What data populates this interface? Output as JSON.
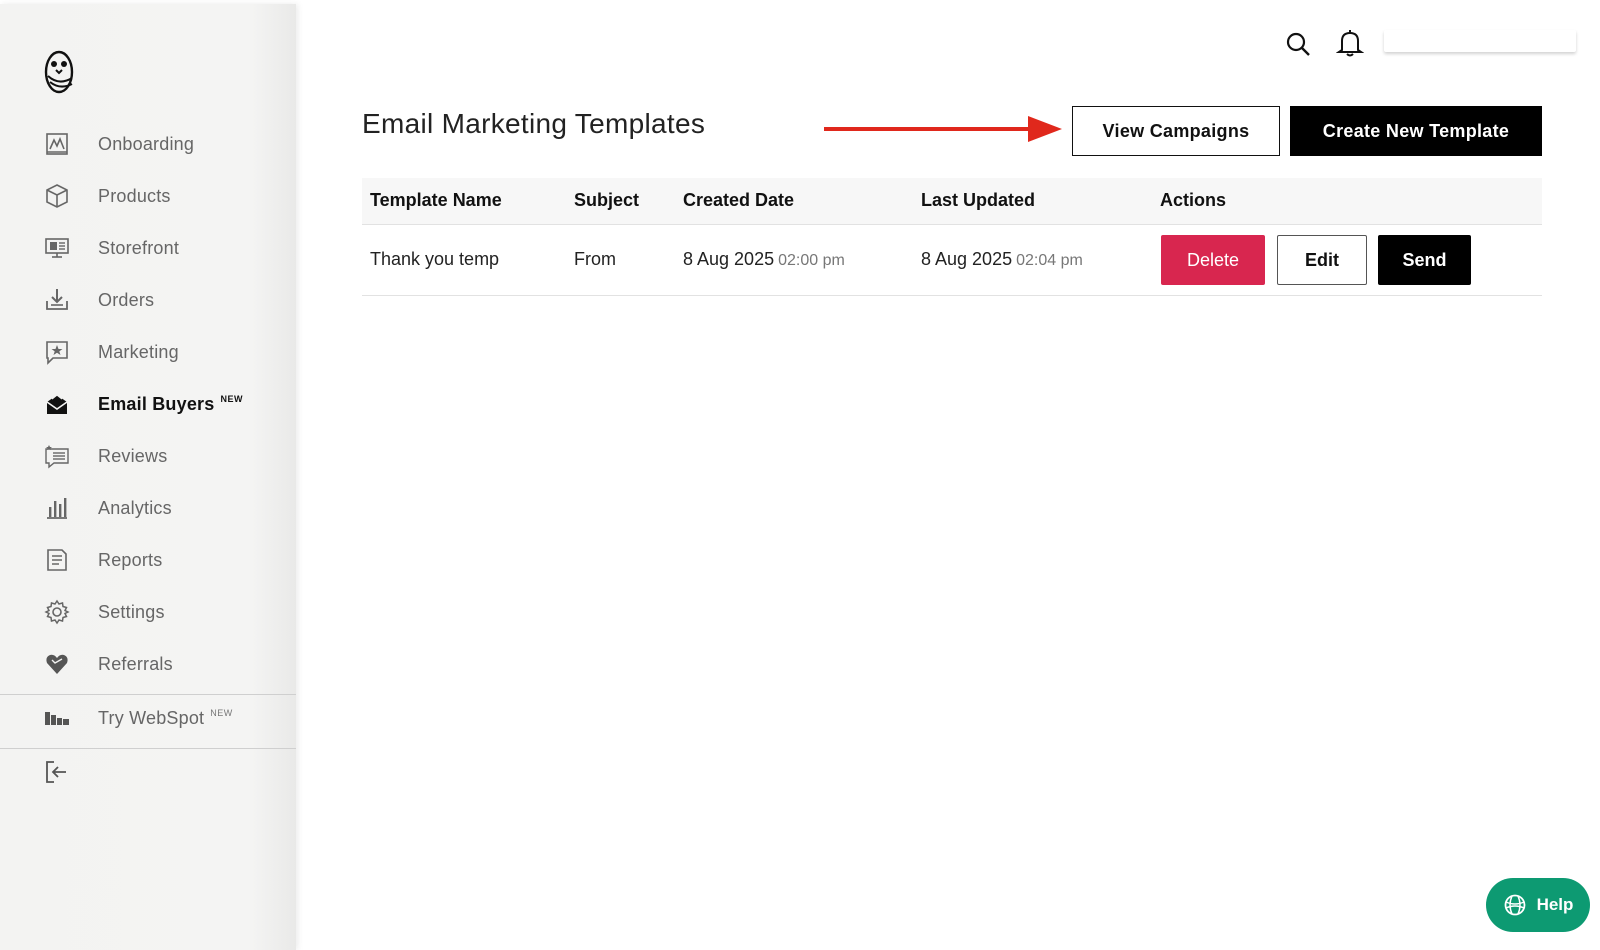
{
  "sidebar": {
    "items": [
      {
        "id": "onboarding",
        "label": "Onboarding",
        "icon": "onboarding-chart-icon"
      },
      {
        "id": "products",
        "label": "Products",
        "icon": "box-icon"
      },
      {
        "id": "storefront",
        "label": "Storefront",
        "icon": "monitor-icon"
      },
      {
        "id": "orders",
        "label": "Orders",
        "icon": "download-tray-icon"
      },
      {
        "id": "marketing",
        "label": "Marketing",
        "icon": "star-message-icon"
      },
      {
        "id": "email-buyers",
        "label": "Email Buyers",
        "badge": "NEW",
        "icon": "envelope-icon",
        "active": true
      },
      {
        "id": "reviews",
        "label": "Reviews",
        "icon": "review-list-icon"
      },
      {
        "id": "analytics",
        "label": "Analytics",
        "icon": "bar-chart-icon"
      },
      {
        "id": "reports",
        "label": "Reports",
        "icon": "document-icon"
      },
      {
        "id": "settings",
        "label": "Settings",
        "icon": "gear-icon"
      },
      {
        "id": "referrals",
        "label": "Referrals",
        "icon": "heart-icon"
      }
    ],
    "webspot": {
      "label": "Try WebSpot",
      "badge": "NEW",
      "icon": "webspot-icon"
    },
    "logout_icon": "logout-icon"
  },
  "header": {
    "search_icon": "search-icon",
    "bell_icon": "bell-icon"
  },
  "main": {
    "title": "Email Marketing Templates",
    "view_campaigns_label": "View Campaigns",
    "create_template_label": "Create New Template"
  },
  "table": {
    "headers": [
      "Template Name",
      "Subject",
      "Created Date",
      "Last Updated",
      "Actions"
    ],
    "rows": [
      {
        "name": "Thank you temp",
        "subject": "From",
        "created_date": "8 Aug 2025",
        "created_time": "02:00 pm",
        "updated_date": "8 Aug 2025",
        "updated_time": "02:04 pm",
        "delete_label": "Delete",
        "edit_label": "Edit",
        "send_label": "Send"
      }
    ]
  },
  "help": {
    "label": "Help",
    "icon": "help-globe-icon"
  },
  "colors": {
    "delete": "#d8264f",
    "help": "#0d9a72",
    "arrow": "#e0281c",
    "primary": "#000000"
  }
}
